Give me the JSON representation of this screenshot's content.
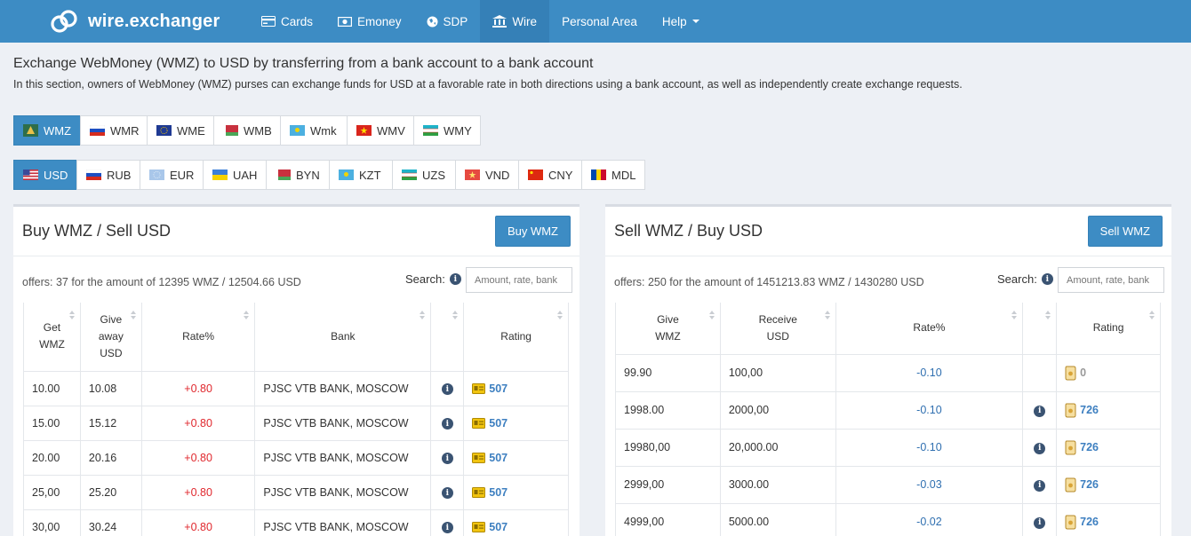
{
  "brand": {
    "name": "wire.exchanger"
  },
  "nav": [
    {
      "label": "Cards",
      "icon": "card-icon"
    },
    {
      "label": "Emoney",
      "icon": "money-icon"
    },
    {
      "label": "SDP",
      "icon": "globe-icon"
    },
    {
      "label": "Wire",
      "icon": "bank-icon",
      "active": true
    },
    {
      "label": "Personal Area",
      "icon": ""
    },
    {
      "label": "Help",
      "icon": "caret-down-icon"
    }
  ],
  "page": {
    "title": "Exchange WebMoney (WMZ) to USD by transferring from a bank account to a bank account",
    "description": "In this section, owners of WebMoney (WMZ) purses can exchange funds for USD at a favorable rate in both directions using a bank account, as well as independently create exchange requests."
  },
  "wm_currencies": [
    "WMZ",
    "WMR",
    "WME",
    "WMB",
    "Wmk",
    "WMV",
    "WMY"
  ],
  "fiat_currencies": [
    "USD",
    "RUB",
    "EUR",
    "UAH",
    "BYN",
    "KZT",
    "UZS",
    "VND",
    "CNY",
    "MDL"
  ],
  "left_panel": {
    "title": "Buy WMZ / Sell USD",
    "button": "Buy WMZ",
    "offers": "offers: 37 for the amount of 12395 WMZ / 12504.66 USD",
    "search_label": "Search:",
    "search_placeholder": "Amount, rate, bank",
    "headers": {
      "get": "Get WMZ",
      "give": "Give away USD",
      "rate": "Rate%",
      "bank": "Bank",
      "info": "",
      "rating": "Rating"
    },
    "rows": [
      {
        "get": "10.00",
        "give": "10.08",
        "rate": "+0.80",
        "bank": "PJSC VTB BANK, MOSCOW",
        "rating": "507"
      },
      {
        "get": "15.00",
        "give": "15.12",
        "rate": "+0.80",
        "bank": "PJSC VTB BANK, MOSCOW",
        "rating": "507"
      },
      {
        "get": "20.00",
        "give": "20.16",
        "rate": "+0.80",
        "bank": "PJSC VTB BANK, MOSCOW",
        "rating": "507"
      },
      {
        "get": "25,00",
        "give": "25.20",
        "rate": "+0.80",
        "bank": "PJSC VTB BANK, MOSCOW",
        "rating": "507"
      },
      {
        "get": "30,00",
        "give": "30.24",
        "rate": "+0.80",
        "bank": "PJSC VTB BANK, MOSCOW",
        "rating": "507"
      }
    ]
  },
  "right_panel": {
    "title": "Sell WMZ / Buy USD",
    "button": "Sell WMZ",
    "offers": "offers: 250 for the amount of 1451213.83 WMZ / 1430280 USD",
    "search_label": "Search:",
    "search_placeholder": "Amount, rate, bank",
    "headers": {
      "give": "Give WMZ",
      "receive": "Receive USD",
      "rate": "Rate%",
      "info": "",
      "rating": "Rating"
    },
    "rows": [
      {
        "give": "99.90",
        "receive": "100,00",
        "rate": "-0.10",
        "info": false,
        "rating": "0"
      },
      {
        "give": "1998.00",
        "receive": "2000,00",
        "rate": "-0.10",
        "info": true,
        "rating": "726"
      },
      {
        "give": "19980,00",
        "receive": "20,000.00",
        "rate": "-0.10",
        "info": true,
        "rating": "726"
      },
      {
        "give": "2999,00",
        "receive": "3000.00",
        "rate": "-0.03",
        "info": true,
        "rating": "726"
      },
      {
        "give": "4999,00",
        "receive": "5000.00",
        "rate": "-0.02",
        "info": true,
        "rating": "726"
      }
    ]
  },
  "colors": {
    "primary": "#3d8cc4",
    "positive_rate": "#e0282e",
    "negative_rate": "#2f6fb0",
    "link": "#3d7fc0"
  }
}
